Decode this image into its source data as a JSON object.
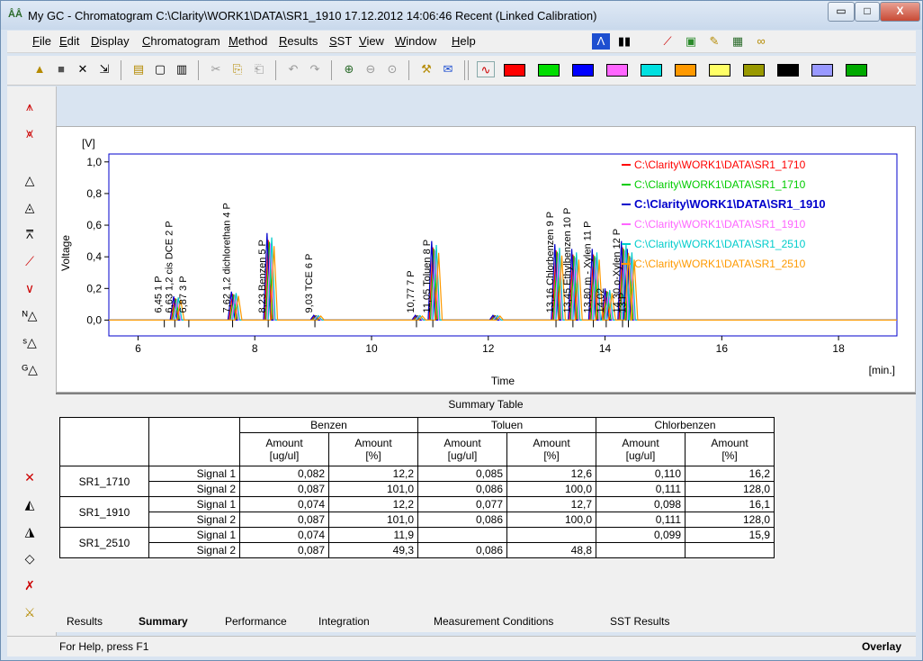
{
  "window": {
    "title": "My GC - Chromatogram  C:\\Clarity\\WORK1\\DATA\\SR1_1910  17.12.2012 14:06:46 Recent (Linked Calibration)",
    "controls": {
      "minimize": "▭",
      "maximize": "□",
      "close": "X"
    }
  },
  "menu": [
    "File",
    "Edit",
    "Display",
    "Chromatogram",
    "Method",
    "Results",
    "SST",
    "View",
    "Window",
    "Help"
  ],
  "toolbar": {
    "colors": [
      "#ff0000",
      "#00dd00",
      "#0000ff",
      "#ff66ff",
      "#00e0e0",
      "#ff9900",
      "#ffff66",
      "#999900",
      "#000000",
      "#9999ff",
      "#00aa00"
    ]
  },
  "chart_data": {
    "type": "line",
    "xlabel": "Time",
    "ylabel": "Voltage",
    "y_unit": "[V]",
    "x_unit": "[min.]",
    "xlim": [
      5.5,
      19.0
    ],
    "ylim": [
      -0.1,
      1.05
    ],
    "x_ticks": [
      "6",
      "8",
      "10",
      "12",
      "14",
      "16",
      "18"
    ],
    "y_ticks": [
      "0,0",
      "0,2",
      "0,4",
      "0,6",
      "0,8",
      "1,0"
    ],
    "peak_labels": [
      {
        "text": "6,45   1 P",
        "x": 6.45
      },
      {
        "text": "6,63 1,2 cis DCE   2 P",
        "x": 6.63
      },
      {
        "text": "6,87   3 P",
        "x": 6.87
      },
      {
        "text": "7,62 1,2 dichlorethan   4 P",
        "x": 7.62
      },
      {
        "text": "8,23 Benzen   5 P",
        "x": 8.23
      },
      {
        "text": "9,03 TCE   6 P",
        "x": 9.03
      },
      {
        "text": "10,77   7 P",
        "x": 10.77
      },
      {
        "text": "11,05 Toluen   8 P",
        "x": 11.05
      },
      {
        "text": "13,16 Chlorbenzen   9 P",
        "x": 13.16
      },
      {
        "text": "13,45 Ethylbenzen   10 P",
        "x": 13.45
      },
      {
        "text": "13,80 m - Xylen   11 P",
        "x": 13.8
      },
      {
        "text": "14,02",
        "x": 14.02
      },
      {
        "text": "14,30 o-Xylen   12 P",
        "x": 14.3
      },
      {
        "text": "13 P",
        "x": 14.4
      }
    ],
    "peaks": [
      {
        "x": 6.63,
        "h": 0.15
      },
      {
        "x": 7.62,
        "h": 0.18
      },
      {
        "x": 8.23,
        "h": 0.55
      },
      {
        "x": 9.03,
        "h": 0.03
      },
      {
        "x": 10.77,
        "h": 0.03
      },
      {
        "x": 11.05,
        "h": 0.5
      },
      {
        "x": 12.1,
        "h": 0.03
      },
      {
        "x": 13.16,
        "h": 0.48
      },
      {
        "x": 13.45,
        "h": 0.45
      },
      {
        "x": 13.8,
        "h": 0.45
      },
      {
        "x": 14.02,
        "h": 0.2
      },
      {
        "x": 14.3,
        "h": 0.5
      },
      {
        "x": 14.4,
        "h": 0.45
      }
    ],
    "series": [
      {
        "name": "C:\\Clarity\\WORK1\\DATA\\SR1_1710",
        "color": "#ff0000"
      },
      {
        "name": "C:\\Clarity\\WORK1\\DATA\\SR1_1710",
        "color": "#00cc00"
      },
      {
        "name": "C:\\Clarity\\WORK1\\DATA\\SR1_1910",
        "color": "#0000cc",
        "bold": true
      },
      {
        "name": "C:\\Clarity\\WORK1\\DATA\\SR1_1910",
        "color": "#ff66ff"
      },
      {
        "name": "C:\\Clarity\\WORK1\\DATA\\SR1_2510",
        "color": "#00cccc"
      },
      {
        "name": "C:\\Clarity\\WORK1\\DATA\\SR1_2510",
        "color": "#ff9900"
      }
    ],
    "legend": "top-right"
  },
  "summary": {
    "title": "Summary Table",
    "groups": [
      "Benzen",
      "Toluen",
      "Chlorbenzen"
    ],
    "col1": "Amount\n[ug/ul]",
    "col2": "Amount\n[%]",
    "samples": [
      {
        "name": "SR1_1710",
        "rows": [
          {
            "signal": "Signal 1",
            "vals": [
              "0,082",
              "12,2",
              "0,085",
              "12,6",
              "0,110",
              "16,2"
            ]
          },
          {
            "signal": "Signal 2",
            "vals": [
              "0,087",
              "101,0",
              "0,086",
              "100,0",
              "0,111",
              "128,0"
            ]
          }
        ]
      },
      {
        "name": "SR1_1910",
        "rows": [
          {
            "signal": "Signal 1",
            "vals": [
              "0,074",
              "12,2",
              "0,077",
              "12,7",
              "0,098",
              "16,1"
            ]
          },
          {
            "signal": "Signal 2",
            "vals": [
              "0,087",
              "101,0",
              "0,086",
              "100,0",
              "0,111",
              "128,0"
            ]
          }
        ]
      },
      {
        "name": "SR1_2510",
        "rows": [
          {
            "signal": "Signal 1",
            "vals": [
              "0,074",
              "11,9",
              "",
              "",
              "0,099",
              "15,9"
            ]
          },
          {
            "signal": "Signal 2",
            "vals": [
              "0,087",
              "49,3",
              "0,086",
              "48,8",
              "",
              ""
            ]
          }
        ]
      }
    ]
  },
  "tabs": [
    "Results",
    "Summary",
    "Performance",
    "Integration",
    "Measurement Conditions",
    "SST Results"
  ],
  "active_tab": "Summary",
  "status": {
    "help": "For Help, press F1",
    "mode": "Overlay"
  }
}
